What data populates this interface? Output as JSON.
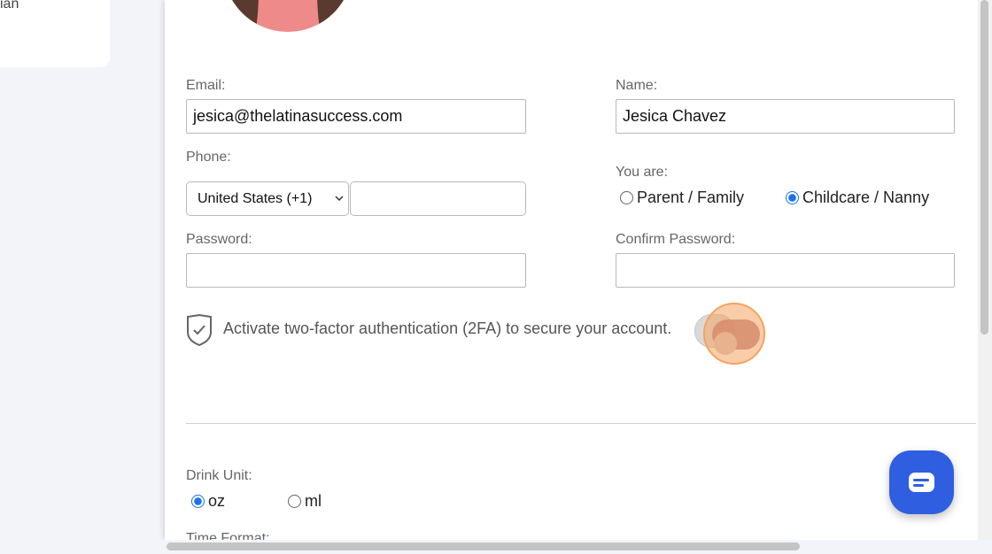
{
  "sidebar": {
    "partial_text": "ian"
  },
  "form": {
    "email_label": "Email:",
    "email_value": "jesica@thelatinasuccess.com",
    "name_label": "Name:",
    "name_value": "Jesica Chavez",
    "phone_label": "Phone:",
    "country_selected": "United States (+1)",
    "phone_value": "",
    "you_are_label": "You are:",
    "role_options": [
      "Parent / Family",
      "Childcare / Nanny"
    ],
    "role_selected": "Childcare / Nanny",
    "password_label": "Password:",
    "confirm_password_label": "Confirm Password:",
    "tfa_text": "Activate two-factor authentication (2FA) to secure your account.",
    "tfa_enabled": false,
    "drink_unit_label": "Drink Unit:",
    "drink_unit_options": [
      "oz",
      "ml"
    ],
    "drink_unit_selected": "oz",
    "time_format_label": "Time Format:"
  },
  "colors": {
    "accent_blue": "#1a73e8",
    "chat_button": "#2f5fe0",
    "highlight": "#f4a460"
  }
}
